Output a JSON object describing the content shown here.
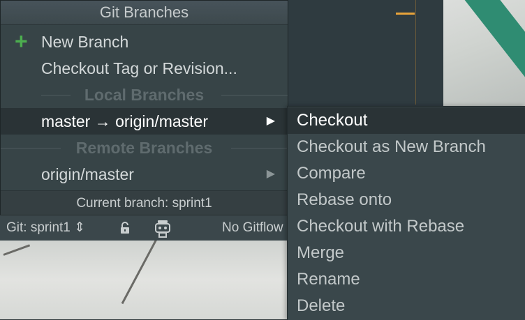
{
  "popup": {
    "title": "Git Branches",
    "actions": [
      {
        "label": "New Branch",
        "icon": "plus-icon"
      },
      {
        "label": "Checkout Tag or Revision..."
      }
    ],
    "local_header": "Local Branches",
    "local_branches": [
      {
        "label": "master → origin/master",
        "selected": true
      }
    ],
    "remote_header": "Remote Branches",
    "remote_branches": [
      {
        "label": "origin/master"
      }
    ],
    "footer": "Current branch: sprint1"
  },
  "statusbar": {
    "git_label": "Git: sprint1 ⇕",
    "gitflow_label": "No Gitflow",
    "icons": [
      "lock-icon",
      "robot-icon"
    ]
  },
  "submenu": {
    "items": [
      "Checkout",
      "Checkout as New Branch",
      "Compare",
      "Rebase onto",
      "Checkout with Rebase",
      "Merge",
      "Rename",
      "Delete"
    ],
    "active": "Checkout"
  },
  "colors": {
    "popup_bg": "#374447",
    "selected_bg": "#2a3336",
    "plus_green": "#4cae4f",
    "header_text": "#5f6b6e",
    "marker_orange": "#e8a33a",
    "wallpaper_green": "#2f8c72"
  }
}
